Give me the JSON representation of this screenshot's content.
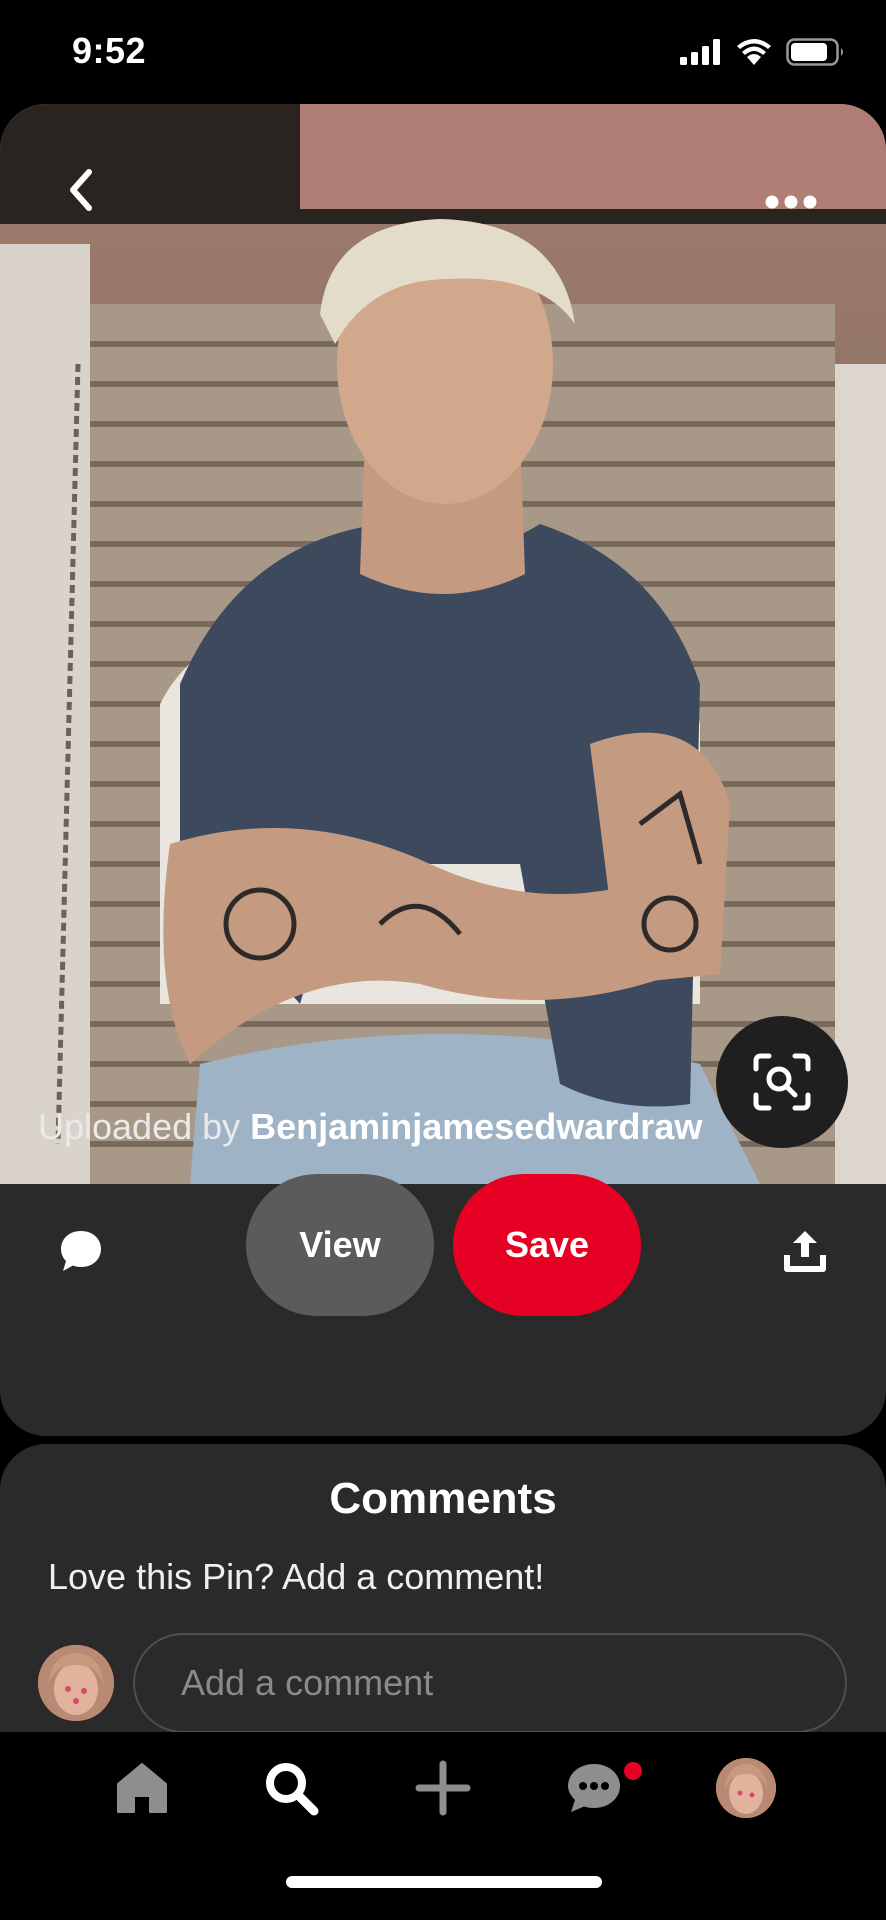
{
  "status_bar": {
    "time": "9:52"
  },
  "pin": {
    "uploaded_prefix": "Uploaded by ",
    "uploader": "Benjaminjamesedwardraw",
    "view_label": "View",
    "save_label": "Save"
  },
  "comments": {
    "title": "Comments",
    "prompt": "Love this Pin? Add a comment!",
    "input_placeholder": "Add a comment"
  },
  "colors": {
    "save": "#e60023",
    "card_bg": "#2a2a2a",
    "view_bg": "#5b5b5b"
  },
  "icons": [
    "back-icon",
    "more-icon",
    "visual-search-icon",
    "comment-icon",
    "share-icon",
    "home-icon",
    "search-icon",
    "add-icon",
    "messages-icon"
  ]
}
